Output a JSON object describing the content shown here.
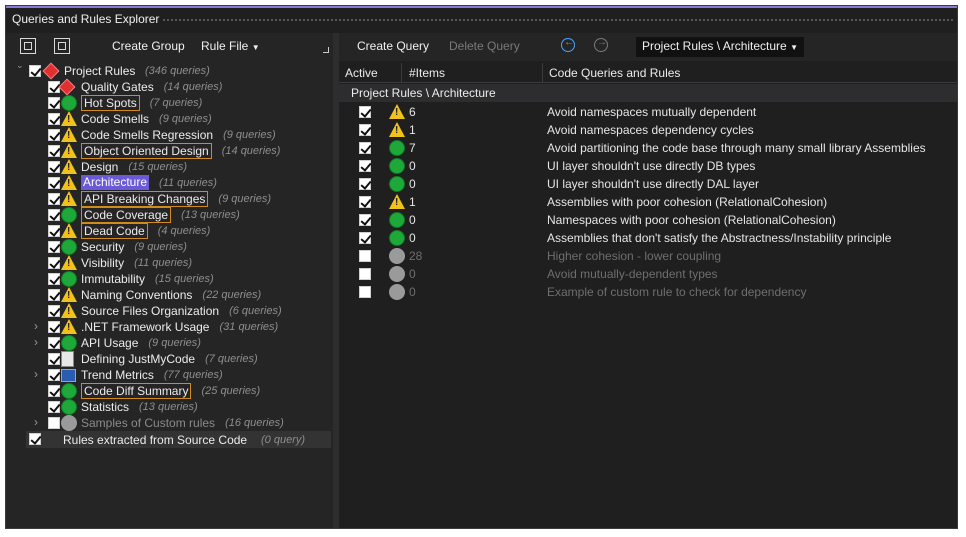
{
  "window": {
    "title": "Queries and Rules Explorer"
  },
  "left_toolbar": {
    "create_group": "Create Group",
    "rule_file": "Rule File"
  },
  "tree": {
    "root": {
      "label": "Project Rules",
      "count": "(346 queries)"
    },
    "items": [
      {
        "label": "Quality Gates",
        "count": "(14 queries)",
        "icon": "critical-icon",
        "style": "normal"
      },
      {
        "label": "Hot Spots",
        "count": "(7 queries)",
        "icon": "ok-icon",
        "style": "highlight"
      },
      {
        "label": "Code Smells",
        "count": "(9 queries)",
        "icon": "warning-icon",
        "style": "normal"
      },
      {
        "label": "Code Smells Regression",
        "count": "(9 queries)",
        "icon": "warning-icon",
        "style": "normal"
      },
      {
        "label": "Object Oriented Design",
        "count": "(14 queries)",
        "icon": "warning-icon",
        "style": "highlight"
      },
      {
        "label": "Design",
        "count": "(15 queries)",
        "icon": "warning-icon",
        "style": "normal"
      },
      {
        "label": "Architecture",
        "count": "(11 queries)",
        "icon": "warning-icon",
        "style": "selected"
      },
      {
        "label": "API Breaking Changes",
        "count": "(9 queries)",
        "icon": "warning-icon",
        "style": "highlight"
      },
      {
        "label": "Code Coverage",
        "count": "(13 queries)",
        "icon": "ok-icon",
        "style": "highlight"
      },
      {
        "label": "Dead Code",
        "count": "(4 queries)",
        "icon": "warning-icon",
        "style": "highlight"
      },
      {
        "label": "Security",
        "count": "(9 queries)",
        "icon": "ok-icon",
        "style": "normal"
      },
      {
        "label": "Visibility",
        "count": "(11 queries)",
        "icon": "warning-icon",
        "style": "normal"
      },
      {
        "label": "Immutability",
        "count": "(15 queries)",
        "icon": "ok-icon",
        "style": "normal"
      },
      {
        "label": "Naming Conventions",
        "count": "(22 queries)",
        "icon": "warning-icon",
        "style": "normal"
      },
      {
        "label": "Source Files Organization",
        "count": "(6 queries)",
        "icon": "warning-icon",
        "style": "normal"
      },
      {
        "label": ".NET Framework Usage",
        "count": "(31 queries)",
        "icon": "warning-icon",
        "style": "normal",
        "expandable": true
      },
      {
        "label": "API Usage",
        "count": "(9 queries)",
        "icon": "ok-icon",
        "style": "normal",
        "expandable": true
      },
      {
        "label": "Defining JustMyCode",
        "count": "(7 queries)",
        "icon": "document-icon",
        "style": "normal"
      },
      {
        "label": "Trend Metrics",
        "count": "(77 queries)",
        "icon": "trend-icon",
        "style": "normal",
        "expandable": true
      },
      {
        "label": "Code Diff Summary",
        "count": "(25 queries)",
        "icon": "ok-icon",
        "style": "highlight"
      },
      {
        "label": "Statistics",
        "count": "(13 queries)",
        "icon": "ok-icon",
        "style": "normal"
      },
      {
        "label": "Samples of Custom rules",
        "count": "(16 queries)",
        "icon": "disabled-icon",
        "style": "dim",
        "expandable": true,
        "unchecked": true
      }
    ],
    "source_rules": {
      "label": "Rules extracted from Source Code",
      "count": "(0 query)"
    }
  },
  "right_toolbar": {
    "create_query": "Create Query",
    "delete_query": "Delete Query",
    "scope": "Project Rules \\ Architecture"
  },
  "grid": {
    "columns": [
      "Active",
      "#Items",
      "Code Queries and Rules"
    ],
    "group": "Project Rules \\ Architecture",
    "rows": [
      {
        "active": true,
        "status": "warning-critical-icon",
        "items": "6",
        "name": "Avoid namespaces mutually dependent"
      },
      {
        "active": true,
        "status": "warning-icon",
        "items": "1",
        "name": "Avoid namespaces dependency cycles"
      },
      {
        "active": true,
        "status": "ok-icon",
        "items": "7",
        "name": "Avoid partitioning the code base through many small library Assemblies"
      },
      {
        "active": true,
        "status": "ok-icon",
        "items": "0",
        "name": "UI layer shouldn't use directly DB types"
      },
      {
        "active": true,
        "status": "ok-icon",
        "items": "0",
        "name": "UI layer shouldn't use directly DAL layer"
      },
      {
        "active": true,
        "status": "warning-icon",
        "items": "1",
        "name": "Assemblies with poor cohesion (RelationalCohesion)"
      },
      {
        "active": true,
        "status": "ok-icon",
        "items": "0",
        "name": "Namespaces with poor cohesion (RelationalCohesion)"
      },
      {
        "active": true,
        "status": "ok-icon",
        "items": "0",
        "name": "Assemblies that don't satisfy the Abstractness/Instability principle"
      },
      {
        "active": false,
        "status": "gray-icon",
        "items": "28",
        "name": "Higher cohesion - lower coupling"
      },
      {
        "active": false,
        "status": "gray-icon",
        "items": "0",
        "name": "Avoid mutually-dependent types"
      },
      {
        "active": false,
        "status": "gray-icon",
        "items": "0",
        "name": "Example of custom rule to check for dependency"
      }
    ]
  }
}
